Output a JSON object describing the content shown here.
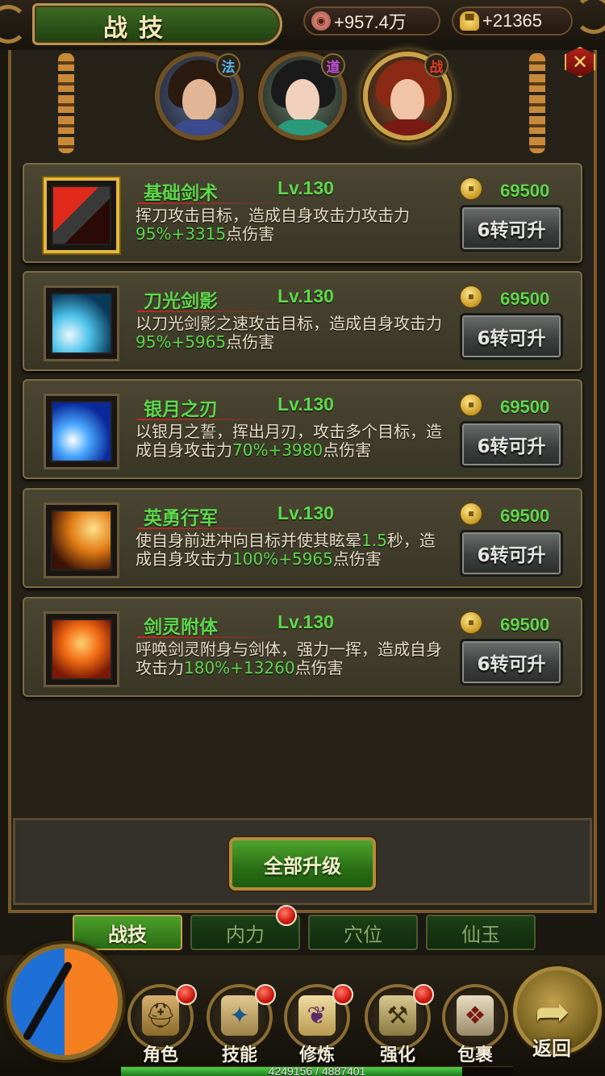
{
  "header": {
    "title": "战技",
    "copper": {
      "icon": "copper-coin-icon",
      "value": "+957.4万"
    },
    "gold": {
      "icon": "gold-ingot-icon",
      "value": "+21365"
    }
  },
  "classes": [
    {
      "badge": "法",
      "badge_color": "#4fb4ff",
      "active": false
    },
    {
      "badge": "道",
      "badge_color": "#c050e0",
      "active": false
    },
    {
      "badge": "战",
      "badge_color": "#e03a30",
      "active": true
    }
  ],
  "skills": [
    {
      "name": "基础剑术",
      "level": "Lv.130",
      "desc_pre": "挥刀攻击目标，造成自身攻击力攻击力",
      "desc_hl": "95%+3315",
      "desc_post": "点伤害",
      "cost": "69500",
      "button": "6转可升",
      "selected": true
    },
    {
      "name": "刀光剑影",
      "level": "Lv.130",
      "desc_pre": "以刀光剑影之速攻击目标，造成自身攻击力",
      "desc_hl": "95%+5965",
      "desc_post": "点伤害",
      "cost": "69500",
      "button": "6转可升",
      "selected": false
    },
    {
      "name": "银月之刃",
      "level": "Lv.130",
      "desc_pre": "以银月之誓，挥出月刃，攻击多个目标，造成自身攻击力",
      "desc_hl": "70%+3980",
      "desc_post": "点伤害",
      "cost": "69500",
      "button": "6转可升",
      "selected": false
    },
    {
      "name": "英勇行军",
      "level": "Lv.130",
      "desc_pre": "使自身前进冲向目标并使其眩晕",
      "desc_hl": "1.5",
      "desc_mid": "秒，造成自身攻击力",
      "desc_hl2": "100%+5965",
      "desc_post": "点伤害",
      "cost": "69500",
      "button": "6转可升",
      "selected": false
    },
    {
      "name": "剑灵附体",
      "level": "Lv.130",
      "desc_pre": "呼唤剑灵附身与剑体，强力一挥，造成自身攻击力",
      "desc_hl": "180%+13260",
      "desc_post": "点伤害",
      "cost": "69500",
      "button": "6转可升",
      "selected": false
    }
  ],
  "upgrade_all": "全部升级",
  "tabs": [
    {
      "label": "战技",
      "active": true,
      "badge": false
    },
    {
      "label": "内力",
      "active": false,
      "badge": true
    },
    {
      "label": "穴位",
      "active": false,
      "badge": false
    },
    {
      "label": "仙玉",
      "active": false,
      "badge": false
    }
  ],
  "nav": [
    {
      "label": "角色",
      "icon": "helmet-icon",
      "badge": true
    },
    {
      "label": "技能",
      "icon": "skill-book-icon",
      "badge": true
    },
    {
      "label": "修炼",
      "icon": "scroll-icon",
      "badge": true
    },
    {
      "label": "强化",
      "icon": "anvil-icon",
      "badge": true
    },
    {
      "label": "包裹",
      "icon": "bag-icon",
      "badge": false
    }
  ],
  "back_label": "返回",
  "experience": {
    "text": "4249156 / 4887401",
    "fraction": 0.8694
  }
}
